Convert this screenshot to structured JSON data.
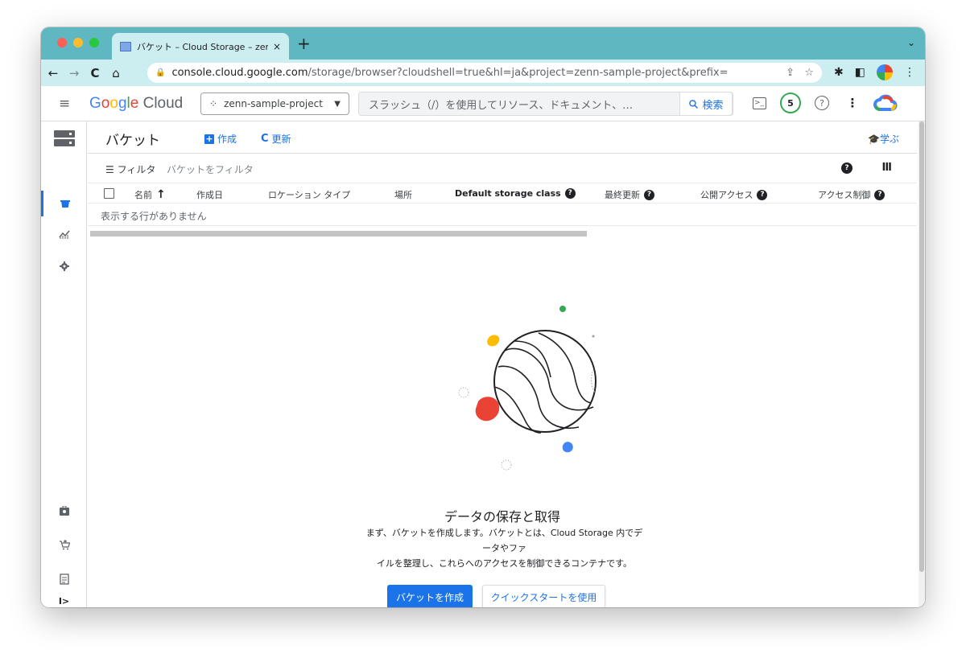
{
  "browser": {
    "tab_title": "バケット – Cloud Storage – zenn",
    "tab_close": "×",
    "new_tab": "+",
    "tab_menu": "⌄",
    "back": "←",
    "forward": "→",
    "reload": "C",
    "home": "⌂",
    "url_host": "console.cloud.google.com",
    "url_path": "/storage/browser?cloudshell=true&hl=ja&project=zenn-sample-project&prefix=",
    "share_icon": "⇪",
    "star_icon": "☆",
    "extensions_icon": "✱",
    "sidepanel_icon": "◧",
    "menu_icon": "⋮"
  },
  "header": {
    "menu_icon": "≡",
    "logo_letters": [
      "G",
      "o",
      "o",
      "g",
      "l",
      "e"
    ],
    "logo_cloud": "Cloud",
    "project_icon": "⁘",
    "project_name": "zenn-sample-project",
    "project_caret": "▼",
    "search_placeholder": "スラッシュ（/）を使用してリソース、ドキュメント、…",
    "search_button": "検索",
    "search_icon": "🔍",
    "terminal_icon": ">_",
    "notifications_count": "5",
    "help_icon": "?",
    "more_icon": "⋮"
  },
  "page": {
    "title": "バケット",
    "create_icon": "+",
    "create_label": "作成",
    "refresh_icon": "C",
    "refresh_label": "更新",
    "learn_label": "🎓学ぶ"
  },
  "filter": {
    "label": "☰ フィルタ",
    "placeholder": "バケットをフィルタ",
    "help_icon": "?",
    "columns_icon": "III"
  },
  "table": {
    "columns": {
      "name": "名前",
      "sort_icon": "↑",
      "created": "作成日",
      "location_type": "ロケーション タイプ",
      "location": "場所",
      "default_storage_class": "Default storage class",
      "last_modified": "最終更新",
      "public_access": "公開アクセス",
      "access_control": "アクセス制御"
    },
    "help_icon": "?",
    "empty_message": "表示する行がありません"
  },
  "empty_state": {
    "title": "データの保存と取得",
    "description_line1": "まず、バケットを作成します。バケットとは、Cloud Storage 内でデータやファ",
    "description_line2": "イルを整理し、これらへのアクセスを制御できるコンテナです。",
    "primary_button": "バケットを作成",
    "secondary_button": "クイックスタートを使用"
  },
  "rail": {
    "product_icon": "storage-icon",
    "items": [
      "bucket-icon",
      "monitoring-icon",
      "settings-icon"
    ],
    "bottom_items": [
      "marketplace-icon",
      "cart-icon",
      "release-notes-icon",
      "expand-icon"
    ],
    "expand_glyph": "I>"
  },
  "colors": {
    "brand_blue": "#1a73e8",
    "tabstrip": "#5fb8c1",
    "green": "#34a853",
    "red": "#ea4335",
    "yellow": "#fbbc04"
  }
}
